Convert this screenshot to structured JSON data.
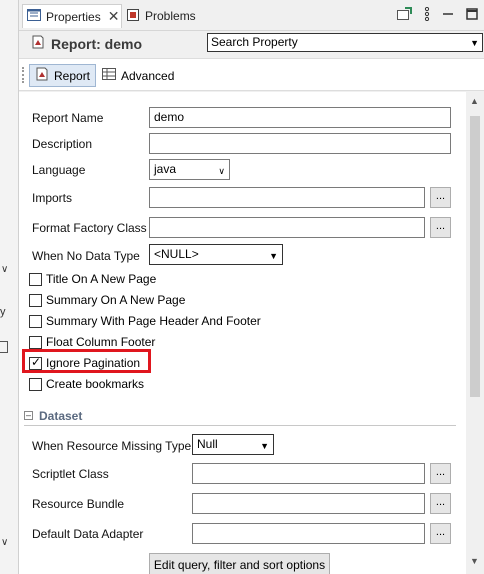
{
  "tabs": [
    {
      "label": "Properties",
      "icon": "properties-icon"
    },
    {
      "label": "Problems",
      "icon": "problems-icon"
    }
  ],
  "header": {
    "title": "Report: demo",
    "search_placeholder": "Search Property"
  },
  "subtabs": [
    {
      "label": "Report",
      "icon": "report-icon"
    },
    {
      "label": "Advanced",
      "icon": "table-icon"
    }
  ],
  "form": {
    "report_name": {
      "label": "Report Name",
      "value": "demo"
    },
    "description": {
      "label": "Description",
      "value": ""
    },
    "language": {
      "label": "Language",
      "value": "java"
    },
    "imports": {
      "label": "Imports",
      "value": ""
    },
    "format_factory": {
      "label": "Format Factory Class",
      "value": ""
    },
    "when_no_data": {
      "label": "When No Data Type",
      "value": "<NULL>"
    },
    "checkboxes": [
      {
        "label": "Title On A New Page",
        "checked": false
      },
      {
        "label": "Summary On A New Page",
        "checked": false
      },
      {
        "label": "Summary With Page Header And Footer",
        "checked": false
      },
      {
        "label": "Float Column Footer",
        "checked": false
      },
      {
        "label": "Ignore Pagination",
        "checked": true
      },
      {
        "label": "Create bookmarks",
        "checked": false
      }
    ]
  },
  "dataset": {
    "section_title": "Dataset",
    "resource_missing": {
      "label": "When Resource Missing Type",
      "value": "Null"
    },
    "scriptlet": {
      "label": "Scriptlet Class",
      "value": ""
    },
    "resource_bundle": {
      "label": "Resource Bundle",
      "value": ""
    },
    "data_adapter": {
      "label": "Default Data Adapter",
      "value": ""
    },
    "edit_button": "Edit query, filter and sort options"
  },
  "buttons": {
    "browse": "..."
  },
  "colors": {
    "highlight": "#e0161e",
    "section_title": "#5b6a80"
  }
}
